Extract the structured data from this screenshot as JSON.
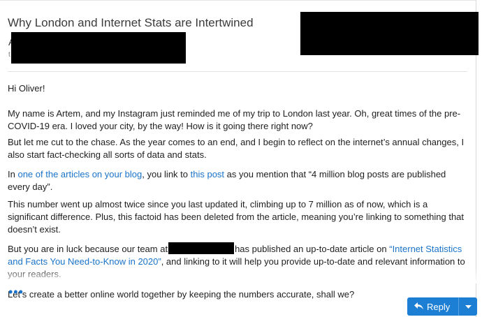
{
  "email": {
    "subject": "Why London and Internet Stats are Intertwined",
    "sender_initial": "A",
    "sender_sub": "t"
  },
  "body": {
    "greeting": "Hi Oliver!",
    "p1": "My name is Artem, and my Instagram just reminded me of my trip to London last year. Oh, great times of the pre-COVID-19 era. I loved your city, by the way! How is it going there right now?",
    "p2": "But let me cut to the chase. As the year comes to an end, and I begin to reflect on the internet’s annual changes, I also start fact-checking all sorts of data and stats.",
    "p3_a": "In ",
    "p3_link1": "one of the articles on your blog",
    "p3_b": ", you link to ",
    "p3_link2": "this post",
    "p3_c": " as you mention that “4 million blog posts are published every day”.",
    "p4": "This number went up almost twice since you last updated it, climbing up to 7 million as of now, which is a significant difference. Plus, this factoid has been deleted from the article, meaning you’re linking to something that doesn’t exist.",
    "p5_a": "But you are in luck because our team at",
    "p5_b": "has published an up-to-date article on ",
    "p5_link": "“Internet Statistics and Facts You Need-to-Know in 2020”",
    "p5_c": ", and linking to it will help you provide up-to-date and relevant information to your readers.",
    "p6": "Let’s create a better online world together by keeping the numbers accurate, shall we?"
  },
  "actions": {
    "more": "•••",
    "reply_label": "Reply",
    "reply_icon": "reply-arrow-icon",
    "caret_icon": "chevron-down-icon"
  },
  "colors": {
    "link": "#1a73c9",
    "button": "#1d7fd4"
  }
}
